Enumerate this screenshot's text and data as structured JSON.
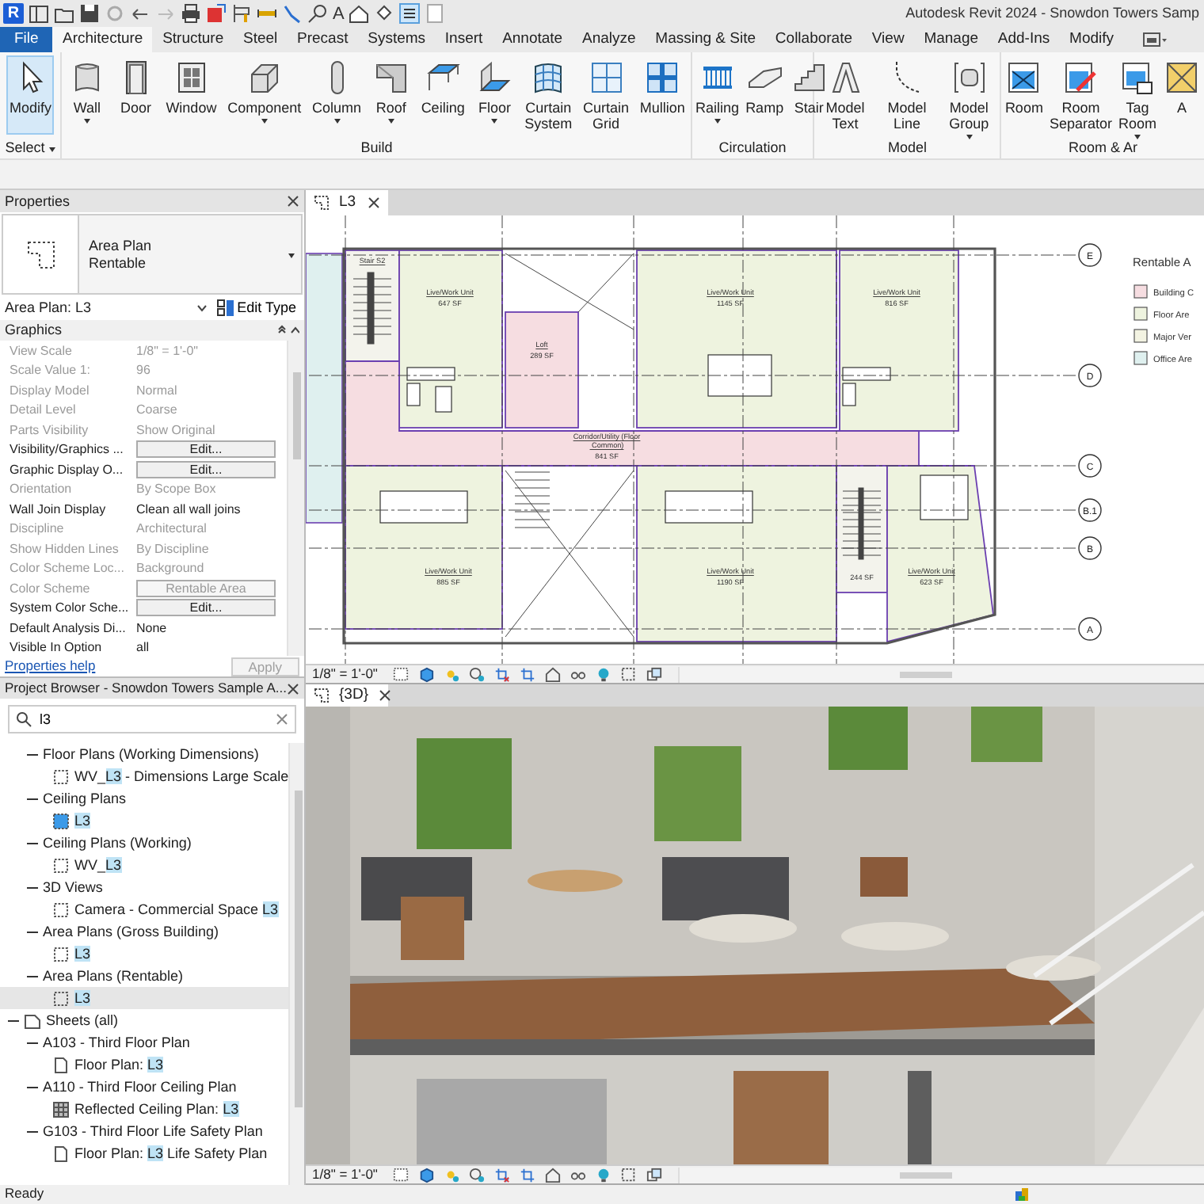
{
  "app": {
    "logo": "R",
    "text_tool": "A",
    "title": "Autodesk Revit 2024 - Snowdon Towers Samp"
  },
  "ribbon_tabs": [
    {
      "label": "File",
      "kind": "file",
      "selected": false
    },
    {
      "label": "Architecture",
      "kind": "tab",
      "selected": true
    },
    {
      "label": "Structure",
      "kind": "tab",
      "selected": false
    },
    {
      "label": "Steel",
      "kind": "tab",
      "selected": false
    },
    {
      "label": "Precast",
      "kind": "tab",
      "selected": false
    },
    {
      "label": "Systems",
      "kind": "tab",
      "selected": false
    },
    {
      "label": "Insert",
      "kind": "tab",
      "selected": false
    },
    {
      "label": "Annotate",
      "kind": "tab",
      "selected": false
    },
    {
      "label": "Analyze",
      "kind": "tab",
      "selected": false
    },
    {
      "label": "Massing & Site",
      "kind": "tab",
      "selected": false
    },
    {
      "label": "Collaborate",
      "kind": "tab",
      "selected": false
    },
    {
      "label": "View",
      "kind": "tab",
      "selected": false
    },
    {
      "label": "Manage",
      "kind": "tab",
      "selected": false
    },
    {
      "label": "Add-Ins",
      "kind": "tab",
      "selected": false
    },
    {
      "label": "Modify",
      "kind": "tab",
      "selected": false
    }
  ],
  "ribbon_panels": [
    {
      "label": "Select",
      "dropdown": true,
      "buttons": [
        {
          "label": "Modify",
          "kind": "pointer",
          "dropdown": false,
          "selected": true
        }
      ]
    },
    {
      "label": "Build",
      "dropdown": false,
      "buttons": [
        {
          "label": "Wall",
          "kind": "wall",
          "dropdown": true,
          "selected": false
        },
        {
          "label": "Door",
          "kind": "door",
          "dropdown": false,
          "selected": false
        },
        {
          "label": "Window",
          "kind": "window",
          "dropdown": false,
          "selected": false
        },
        {
          "label": "Component",
          "kind": "component",
          "dropdown": true,
          "selected": false
        },
        {
          "label": "Column",
          "kind": "column",
          "dropdown": true,
          "selected": false
        },
        {
          "label": "Roof",
          "kind": "roof",
          "dropdown": true,
          "selected": false
        },
        {
          "label": "Ceiling",
          "kind": "ceiling",
          "dropdown": false,
          "selected": false
        },
        {
          "label": "Floor",
          "kind": "floor",
          "dropdown": true,
          "selected": false
        },
        {
          "label": "Curtain System",
          "kind": "curtain-system",
          "dropdown": false,
          "selected": false
        },
        {
          "label": "Curtain Grid",
          "kind": "curtain-grid",
          "dropdown": false,
          "selected": false
        },
        {
          "label": "Mullion",
          "kind": "mullion",
          "dropdown": false,
          "selected": false
        }
      ]
    },
    {
      "label": "Circulation",
      "dropdown": false,
      "buttons": [
        {
          "label": "Railing",
          "kind": "railing",
          "dropdown": true,
          "selected": false
        },
        {
          "label": "Ramp",
          "kind": "ramp",
          "dropdown": false,
          "selected": false
        },
        {
          "label": "Stair",
          "kind": "stair",
          "dropdown": false,
          "selected": false
        }
      ]
    },
    {
      "label": "Model",
      "dropdown": false,
      "buttons": [
        {
          "label": "Model Text",
          "kind": "model-text",
          "dropdown": false,
          "selected": false
        },
        {
          "label": "Model Line",
          "kind": "model-line",
          "dropdown": false,
          "selected": false
        },
        {
          "label": "Model Group",
          "kind": "model-group",
          "dropdown": true,
          "selected": false
        }
      ]
    },
    {
      "label": "Room & Ar",
      "dropdown": false,
      "buttons": [
        {
          "label": "Room",
          "kind": "room",
          "dropdown": false,
          "selected": false
        },
        {
          "label": "Room Separator",
          "kind": "room-separator",
          "dropdown": false,
          "selected": false
        },
        {
          "label": "Tag Room",
          "kind": "tag-room",
          "dropdown": true,
          "selected": false
        },
        {
          "label": "A",
          "kind": "area",
          "dropdown": false,
          "selected": false
        }
      ]
    }
  ],
  "properties": {
    "title": "Properties",
    "family": "Area Plan",
    "type": "Rentable",
    "instance": "Area Plan: L3",
    "edit_type": "Edit Type",
    "group": "Graphics",
    "rows": [
      {
        "name": "View Scale",
        "value": "1/8\" = 1'-0\"",
        "kind": "text",
        "disabled": true
      },
      {
        "name": "Scale Value    1:",
        "value": "96",
        "kind": "text",
        "disabled": true
      },
      {
        "name": "Display Model",
        "value": "Normal",
        "kind": "text",
        "disabled": true
      },
      {
        "name": "Detail Level",
        "value": "Coarse",
        "kind": "text",
        "disabled": true
      },
      {
        "name": "Parts Visibility",
        "value": "Show Original",
        "kind": "text",
        "disabled": true
      },
      {
        "name": "Visibility/Graphics ...",
        "value": "Edit...",
        "kind": "button",
        "disabled": false
      },
      {
        "name": "Graphic Display O...",
        "value": "Edit...",
        "kind": "button",
        "disabled": false
      },
      {
        "name": "Orientation",
        "value": "By Scope Box",
        "kind": "text",
        "disabled": true
      },
      {
        "name": "Wall Join Display",
        "value": "Clean all wall joins",
        "kind": "text",
        "disabled": false
      },
      {
        "name": "Discipline",
        "value": "Architectural",
        "kind": "text",
        "disabled": true
      },
      {
        "name": "Show Hidden Lines",
        "value": "By Discipline",
        "kind": "text",
        "disabled": true
      },
      {
        "name": "Color Scheme Loc...",
        "value": "Background",
        "kind": "text",
        "disabled": true
      },
      {
        "name": "Color Scheme",
        "value": "Rentable Area",
        "kind": "button",
        "disabled": true
      },
      {
        "name": "System Color Sche...",
        "value": "Edit...",
        "kind": "button",
        "disabled": false
      },
      {
        "name": "Default Analysis Di...",
        "value": "None",
        "kind": "text",
        "disabled": false
      },
      {
        "name": "Visible In Option",
        "value": "all",
        "kind": "text",
        "disabled": false
      }
    ],
    "help_link": "Properties help",
    "apply": {
      "label": "Apply",
      "disabled": true
    }
  },
  "browser": {
    "title": "Project Browser - Snowdon Towers Sample A...",
    "search": {
      "value": "l3"
    },
    "tree": [
      {
        "children": [
          {
            "label": "Floor Plans (Working Dimensions)",
            "kind": "category",
            "expanded": true,
            "selected": false,
            "children": [
              {
                "kind": "view",
                "prefix": "WV_",
                "match": "L3",
                "suffix": " - Dimensions Large Scale",
                "selected": false
              }
            ]
          },
          {
            "label": "Ceiling Plans",
            "kind": "category",
            "expanded": true,
            "selected": false,
            "children": [
              {
                "kind": "open-view",
                "match": "L3",
                "selected": false
              }
            ]
          },
          {
            "label": "Ceiling Plans (Working)",
            "kind": "category",
            "expanded": true,
            "selected": false,
            "children": [
              {
                "kind": "view",
                "prefix": "WV_",
                "match": "L3",
                "selected": false
              }
            ]
          },
          {
            "label": "3D Views",
            "kind": "category",
            "expanded": true,
            "selected": false,
            "children": [
              {
                "kind": "view",
                "prefix": "Camera - Commercial Space ",
                "match": "L3",
                "selected": false
              }
            ]
          },
          {
            "label": "Area Plans (Gross Building)",
            "kind": "category",
            "expanded": true,
            "selected": false,
            "children": [
              {
                "kind": "view",
                "match": "L3",
                "selected": false
              }
            ]
          },
          {
            "label": "Area Plans (Rentable)",
            "kind": "category",
            "expanded": true,
            "selected": false,
            "children": [
              {
                "kind": "view",
                "match": "L3",
                "selected": true
              }
            ]
          }
        ]
      },
      {
        "label": "Sheets (all)",
        "kind": "sheets",
        "expanded": true,
        "selected": false,
        "children": [
          {
            "label": "A103 - Third Floor Plan",
            "kind": "category",
            "expanded": true,
            "selected": false,
            "children": [
              {
                "kind": "sheet-view",
                "prefix": "Floor Plan: ",
                "match": "L3",
                "selected": false
              }
            ]
          },
          {
            "label": "A110 - Third Floor Ceiling Plan",
            "kind": "category",
            "expanded": true,
            "selected": false,
            "children": [
              {
                "kind": "ceiling-view",
                "prefix": "Reflected Ceiling Plan: ",
                "match": "L3",
                "selected": false
              }
            ]
          },
          {
            "label": "G103 - Third Floor Life Safety Plan",
            "kind": "category",
            "expanded": true,
            "selected": false,
            "children": [
              {
                "kind": "sheet-view",
                "prefix": "Floor Plan: ",
                "match": "L3",
                "suffix": " Life Safety Plan",
                "selected": false
              }
            ]
          }
        ]
      }
    ]
  },
  "plan_view": {
    "tab": "L3",
    "scale": "1/8\" = 1'-0\"",
    "rooms": [
      {
        "name": "Stair S2",
        "color": "#f3f3ec"
      },
      {
        "name": "Live/Work Unit",
        "area": "647 SF",
        "color": "#eef3df"
      },
      {
        "name": "Loft",
        "area": "289 SF",
        "color": "#f6dde1"
      },
      {
        "name": "Live/Work Unit",
        "area": "1145 SF",
        "color": "#eef3df"
      },
      {
        "name": "Live/Work Unit",
        "area": "816 SF",
        "color": "#eef3df"
      },
      {
        "name": "Corridor/Utility (Floor Common)",
        "area": "841 SF",
        "color": "#f6dde1"
      },
      {
        "name": "Live/Work Unit",
        "area": "885 SF",
        "color": "#eef3df"
      },
      {
        "name": "Live/Work Unit",
        "area": "1190 SF",
        "color": "#eef3df"
      },
      {
        "area": "244 SF",
        "color": "#f3f3ec"
      },
      {
        "name": "Live/Work Unit",
        "area": "623 SF",
        "color": "#eef3df"
      }
    ],
    "grid_bubbles": [
      "E",
      "D",
      "C",
      "B.1",
      "B",
      "A"
    ],
    "legend": {
      "title": "Rentable A",
      "items": [
        {
          "label": "Building C",
          "color": "#f6dde1"
        },
        {
          "label": "Floor Are",
          "color": "#eef3df"
        },
        {
          "label": "Major Ver",
          "color": "#f3f3e2"
        },
        {
          "label": "Office Are",
          "color": "#dff0ef"
        }
      ]
    }
  },
  "view_3d": {
    "tab": "{3D}",
    "scale": "1/8\" = 1'-0\""
  },
  "status_bar": {
    "text": "Ready"
  }
}
